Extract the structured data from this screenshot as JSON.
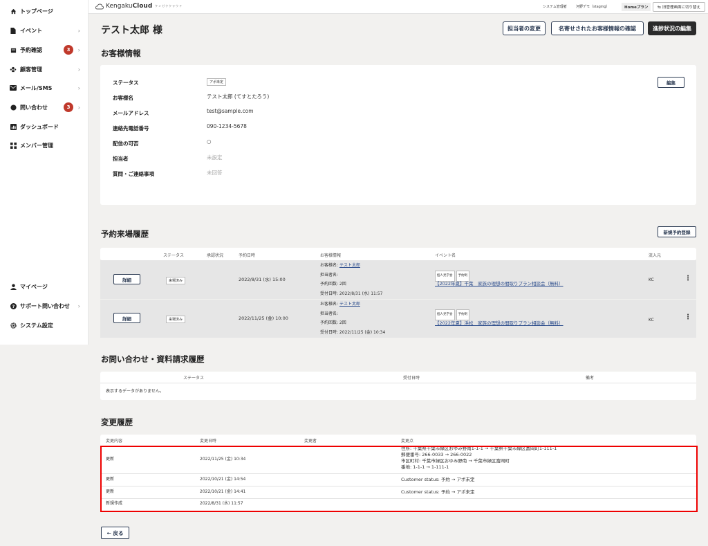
{
  "sidebar": {
    "items": [
      {
        "label": "トップページ",
        "icon": "home-icon",
        "chev": false
      },
      {
        "label": "イベント",
        "icon": "document-icon",
        "chev": true
      },
      {
        "label": "予約確認",
        "icon": "calendar-icon",
        "chev": true,
        "badge": "3"
      },
      {
        "label": "顧客管理",
        "icon": "users-icon",
        "chev": true
      },
      {
        "label": "メール/SMS",
        "icon": "mail-icon",
        "chev": true
      },
      {
        "label": "問い合わせ",
        "icon": "chat-icon",
        "chev": true,
        "badge": "3"
      },
      {
        "label": "ダッシュボード",
        "icon": "chart-icon",
        "chev": false
      },
      {
        "label": "メンバー管理",
        "icon": "grid-icon",
        "chev": false
      }
    ],
    "bottom_items": [
      {
        "label": "マイページ",
        "icon": "person-icon",
        "chev": false
      },
      {
        "label": "サポート問い合わせ",
        "icon": "help-icon",
        "chev": true
      },
      {
        "label": "システム設定",
        "icon": "gear-icon",
        "chev": false
      }
    ]
  },
  "header": {
    "logo_main": "Kengaku",
    "logo_bold": "Cloud",
    "logo_sub": "ケンガククラウド",
    "role": "システム管理者",
    "user": "河野デモ（staging）",
    "plan": "Homeプラン",
    "switch_label": "旧管理画面に切り替え"
  },
  "page": {
    "title": "テスト太郎 様",
    "btn_change_staff": "担当者の変更",
    "btn_merged_info": "名寄せされたお客様情報の確認",
    "btn_edit_progress": "進捗状況の編集"
  },
  "customer": {
    "section_title": "お客様情報",
    "edit_label": "編集",
    "fields": [
      {
        "label": "ステータス",
        "value": "アポ未定"
      },
      {
        "label": "お客様名",
        "value": "テスト太郎 (てすとたろう)"
      },
      {
        "label": "メールアドレス",
        "value": "test@sample.com"
      },
      {
        "label": "連絡先電話番号",
        "value": "090-1234-5678"
      },
      {
        "label": "配信の可否",
        "value": "○"
      },
      {
        "label": "担当者",
        "value": "未設定"
      },
      {
        "label": "質問・ご連絡事項",
        "value": "未回答"
      }
    ]
  },
  "reservations": {
    "section_title": "予約来場履歴",
    "new_label": "新規予約登録",
    "headers": [
      "ステータス",
      "承認状況",
      "予約日時",
      "お客様情報",
      "イベント名",
      "流入元"
    ],
    "rows": [
      {
        "detail": "詳細",
        "status": "来場済み",
        "datetime": "2022/8/31 (水) 15:00",
        "cust_name_label": "お客様名: ",
        "cust_name": "テスト太郎",
        "staff": "担当者名:",
        "count": "予約回数: 2回",
        "received": "受付日時: 2022/8/31 (水) 11:57",
        "tags": [
          "個人見学会",
          "予約制"
        ],
        "event": "【2022年夏】千葉　家族の理想の間取りプラン相談会（無料）",
        "source": "KC"
      },
      {
        "detail": "詳細",
        "status": "来場済み",
        "datetime": "2022/11/25 (金) 10:00",
        "cust_name_label": "お客様名: ",
        "cust_name": "テスト太郎",
        "staff": "担当者名:",
        "count": "予約回数: 2回",
        "received": "受付日時: 2022/11/25 (金) 10:34",
        "tags": [
          "個人見学会",
          "予約制"
        ],
        "event": "【2022年夏】浜松　家族の理想の間取りプラン相談会（無料）",
        "source": "KC"
      }
    ]
  },
  "inquiries": {
    "section_title": "お問い合わせ・資料請求履歴",
    "headers": [
      "ステータス",
      "受付日時",
      "備考"
    ],
    "empty": "表示するデータがありません。"
  },
  "changes": {
    "section_title": "変更履歴",
    "headers": [
      "変更内容",
      "変更日時",
      "変更者",
      "変更点"
    ],
    "rows": [
      {
        "type": "更新",
        "date": "2022/11/25 (金) 10:34",
        "by": "",
        "details": [
          "住所: 千葉県千葉市緑区おゆみ野南1-1-1 → 千葉県千葉市緑区富岡町1-111-1",
          "郵便番号: 266-0033 → 266-0022",
          "市区町村: 千葉市緑区おゆみ野南 → 千葉市緑区富岡町",
          "番地: 1-1-1 → 1-111-1"
        ]
      },
      {
        "type": "更新",
        "date": "2022/10/21 (金) 14:54",
        "by": "",
        "details": [
          "Customer status: 予約 → アポ未定"
        ]
      },
      {
        "type": "更新",
        "date": "2022/10/21 (金) 14:41",
        "by": "",
        "details": [
          "Customer status: 予約 → アポ未定"
        ]
      },
      {
        "type": "新規作成",
        "date": "2022/8/31 (水) 11:57",
        "by": "",
        "details": []
      }
    ]
  },
  "back_label": "← 戻る"
}
